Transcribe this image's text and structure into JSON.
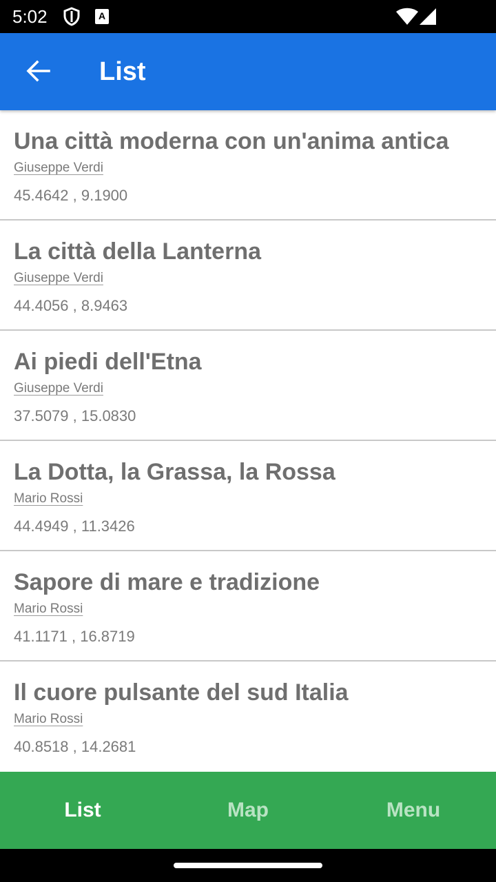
{
  "status_bar": {
    "time": "5:02",
    "icons": [
      "shield-icon",
      "a-notification-icon",
      "wifi-icon",
      "cell-signal-icon"
    ],
    "a_glyph": "A"
  },
  "app_bar": {
    "title": "List",
    "back_icon": "arrow-left-icon",
    "color": "#1a73e3"
  },
  "list": {
    "items": [
      {
        "title": "Una città moderna con un'anima antica",
        "author": "Giuseppe Verdi",
        "coords": "45.4642 , 9.1900"
      },
      {
        "title": "La città della Lanterna",
        "author": "Giuseppe Verdi",
        "coords": "44.4056 , 8.9463"
      },
      {
        "title": "Ai piedi dell'Etna",
        "author": "Giuseppe Verdi",
        "coords": "37.5079 , 15.0830"
      },
      {
        "title": "La Dotta, la Grassa, la Rossa",
        "author": "Mario Rossi",
        "coords": "44.4949 , 11.3426"
      },
      {
        "title": "Sapore di mare e tradizione",
        "author": "Mario Rossi",
        "coords": "41.1171 , 16.8719"
      },
      {
        "title": "Il cuore pulsante del sud Italia",
        "author": "Mario Rossi",
        "coords": "40.8518 , 14.2681"
      }
    ]
  },
  "bottom_nav": {
    "color": "#34a853",
    "tabs": [
      {
        "label": "List",
        "active": true
      },
      {
        "label": "Map",
        "active": false
      },
      {
        "label": "Menu",
        "active": false
      }
    ]
  }
}
